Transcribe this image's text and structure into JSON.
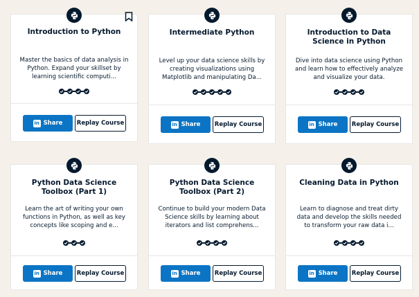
{
  "colors": {
    "primary": "#0b74c4",
    "navy": "#05192d",
    "page_bg": "#f5f1ea"
  },
  "icons": {
    "course_badge": "python-icon",
    "bookmark": "bookmark-icon",
    "share": "linkedin-icon",
    "progress": "check-icon"
  },
  "share_label": "Share",
  "replay_label": "Replay Course",
  "linkedin_glyph": "in",
  "cards": [
    {
      "title": "Introduction to Python",
      "description": "Master the basics of data analysis in Python. Expand your skillset by learning scientific computi...",
      "progress_steps": 4,
      "bookmarked": true
    },
    {
      "title": "Intermediate Python",
      "description": "Level up your data science skills by creating visualizations using Matplotlib and manipulating Da...",
      "progress_steps": 5,
      "bookmarked": false
    },
    {
      "title": "Introduction to Data Science in Python",
      "description": "Dive into data science using Python and learn how to effectively analyze and visualize your data.",
      "progress_steps": 4,
      "bookmarked": false
    },
    {
      "title": "Python Data Science Toolbox (Part 1)",
      "description": "Learn the art of writing your own functions in Python, as well as key concepts like scoping and e...",
      "progress_steps": 3,
      "bookmarked": false
    },
    {
      "title": "Python Data Science Toolbox (Part 2)",
      "description": "Continue to build your modern Data Science skills by learning about iterators and list comprehens...",
      "progress_steps": 4,
      "bookmarked": false
    },
    {
      "title": "Cleaning Data in Python",
      "description": "Learn to diagnose and treat dirty data and develop the skills needed to transform your raw data i...",
      "progress_steps": 4,
      "bookmarked": false
    }
  ]
}
